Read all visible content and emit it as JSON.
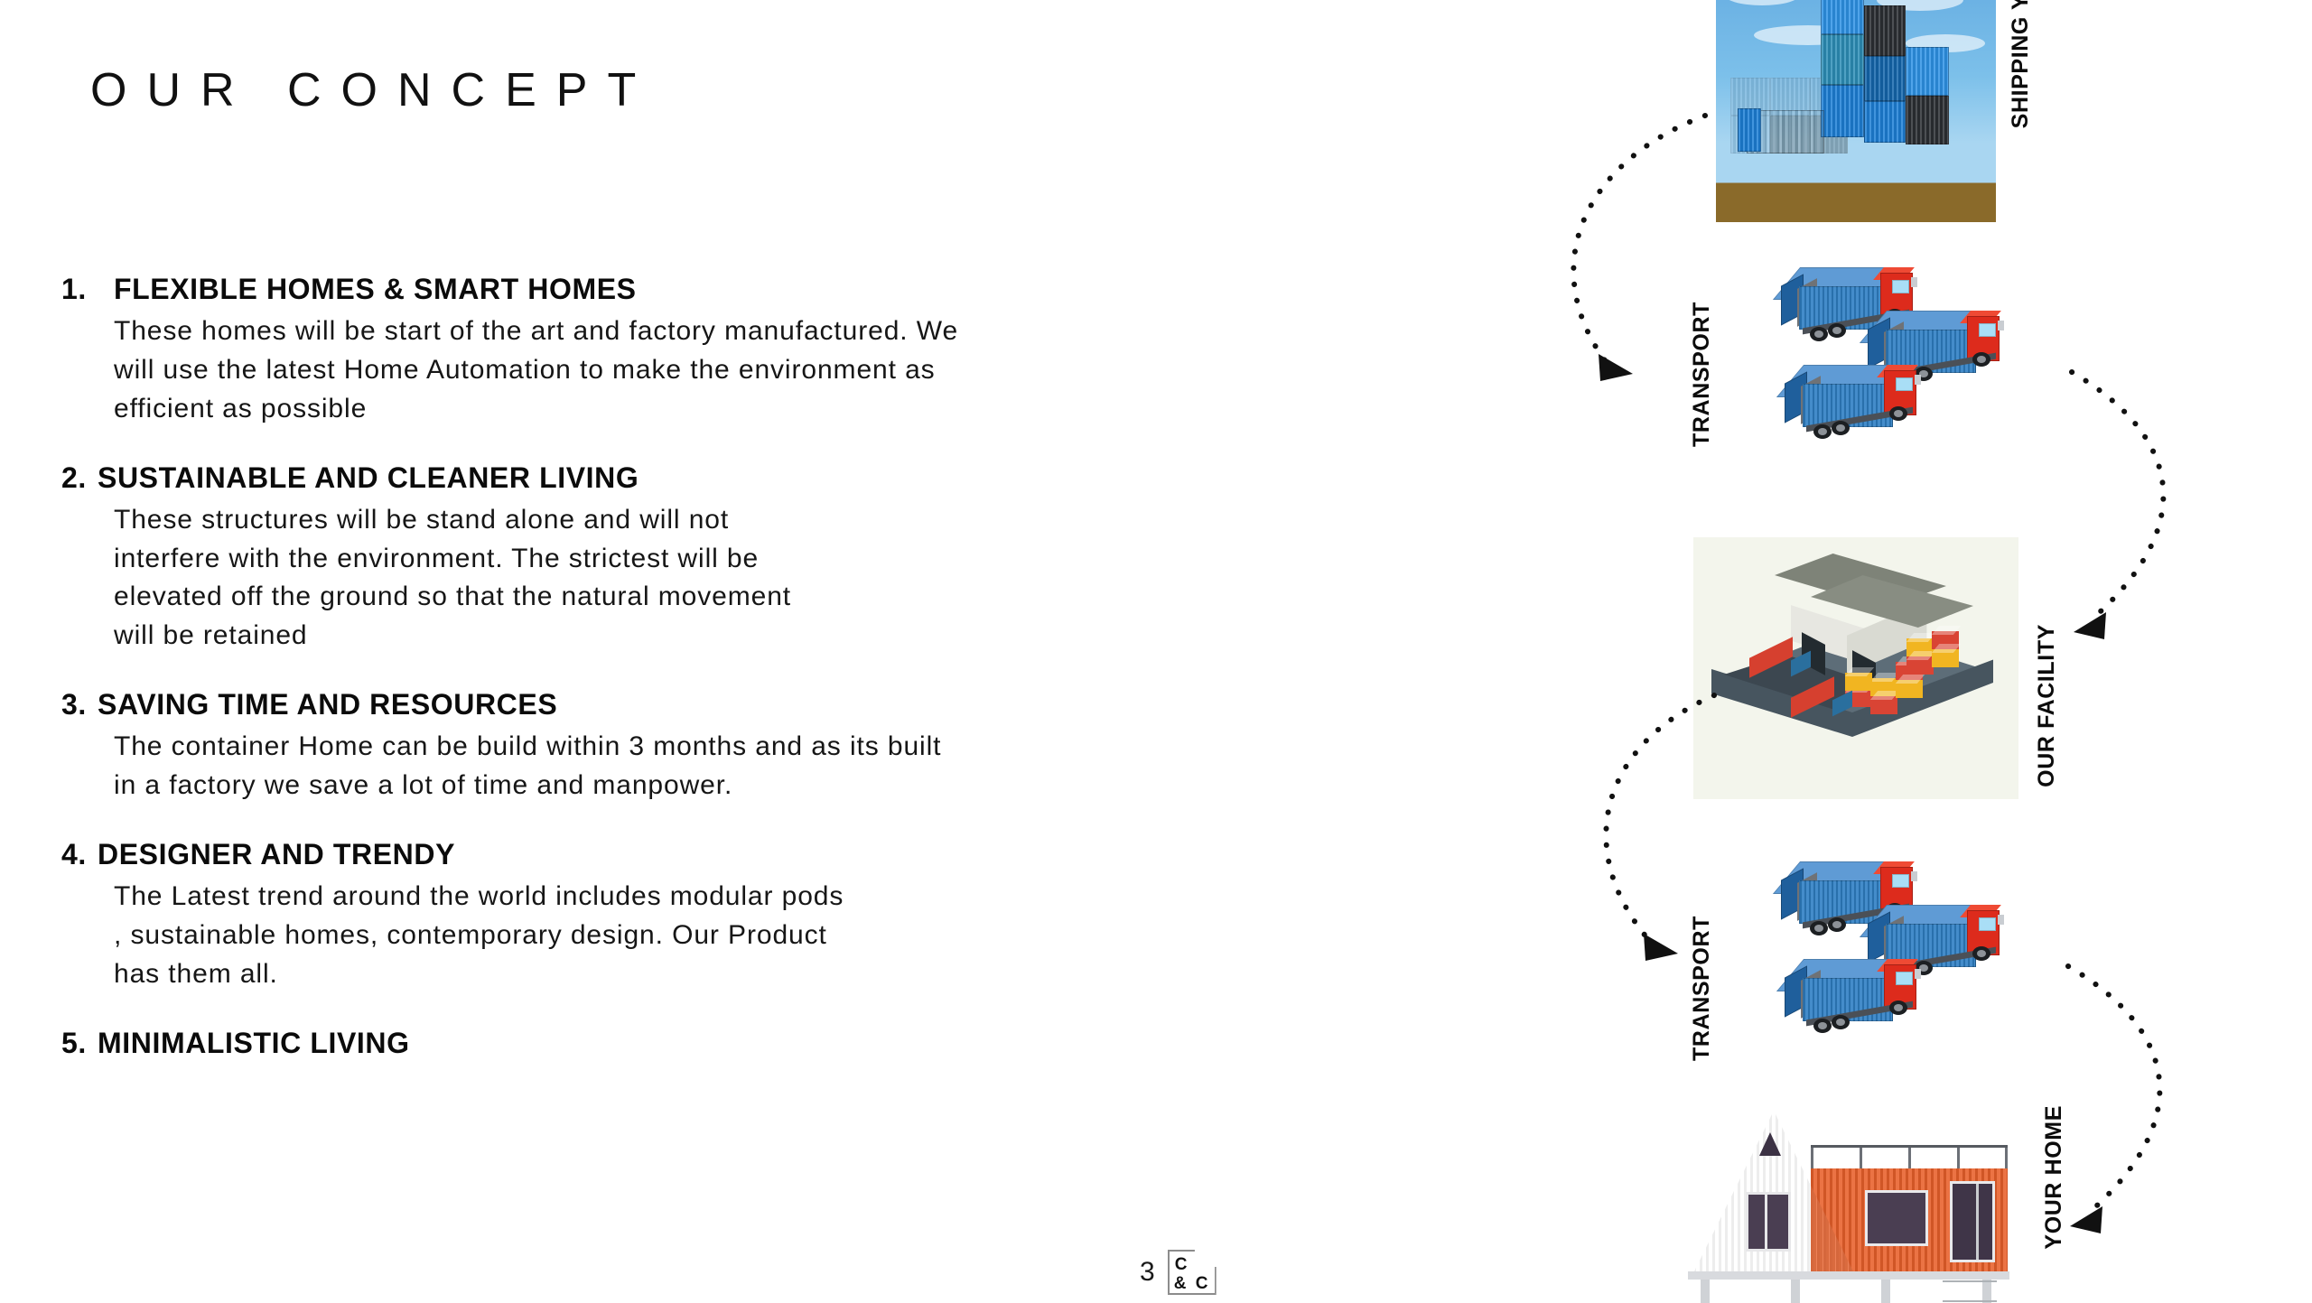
{
  "slide": {
    "title": "OUR CONCEPT",
    "page_number": "3"
  },
  "logo": {
    "glyph_top_left": "C",
    "glyph_bottom_left": "&",
    "glyph_bottom_right": "C"
  },
  "concepts": [
    {
      "number": "1.",
      "title": "FLEXIBLE HOMES & SMART HOMES",
      "lines": [
        "These homes will be start of the art and factory manufactured. We",
        "will use the latest Home Automation to make the environment as",
        "efficient as possible"
      ]
    },
    {
      "number": "2.",
      "title": "SUSTAINABLE AND CLEANER LIVING",
      "lines": [
        "These structures will be stand alone and will not",
        "interfere with the environment. The strictest will be",
        "elevated off the ground so that the natural movement",
        "will be retained"
      ]
    },
    {
      "number": "3.",
      "title": "SAVING TIME AND RESOURCES",
      "lines": [
        "The container Home can be build within 3 months and as its built",
        "in a factory we save a lot of time and manpower."
      ]
    },
    {
      "number": "4.",
      "title": "DESIGNER AND TRENDY",
      "lines": [
        "The Latest trend around the world includes modular pods",
        ", sustainable homes, contemporary design. Our Product",
        "has them all."
      ]
    },
    {
      "number": "5.",
      "title": "MINIMALISTIC LIVING",
      "lines": []
    }
  ],
  "flow": {
    "stages": [
      {
        "label": "SHIPPING YARD",
        "icon": "shipping-containers-photo"
      },
      {
        "label": "TRANSPORT",
        "icon": "container-trucks-illustration"
      },
      {
        "label": "OUR FACILITY",
        "icon": "isometric-warehouse-illustration"
      },
      {
        "label": "TRANSPORT",
        "icon": "container-trucks-illustration"
      },
      {
        "label": "YOUR HOME",
        "icon": "container-home-illustration"
      }
    ],
    "connector": "dotted-curved-arrow"
  },
  "colors": {
    "text": "#101010",
    "container_blue": "#2f7fc4",
    "truck_red": "#dd2b1c",
    "home_orange": "#e8602a",
    "facility_bg": "#f3f5ec",
    "arrow": "#111111"
  }
}
